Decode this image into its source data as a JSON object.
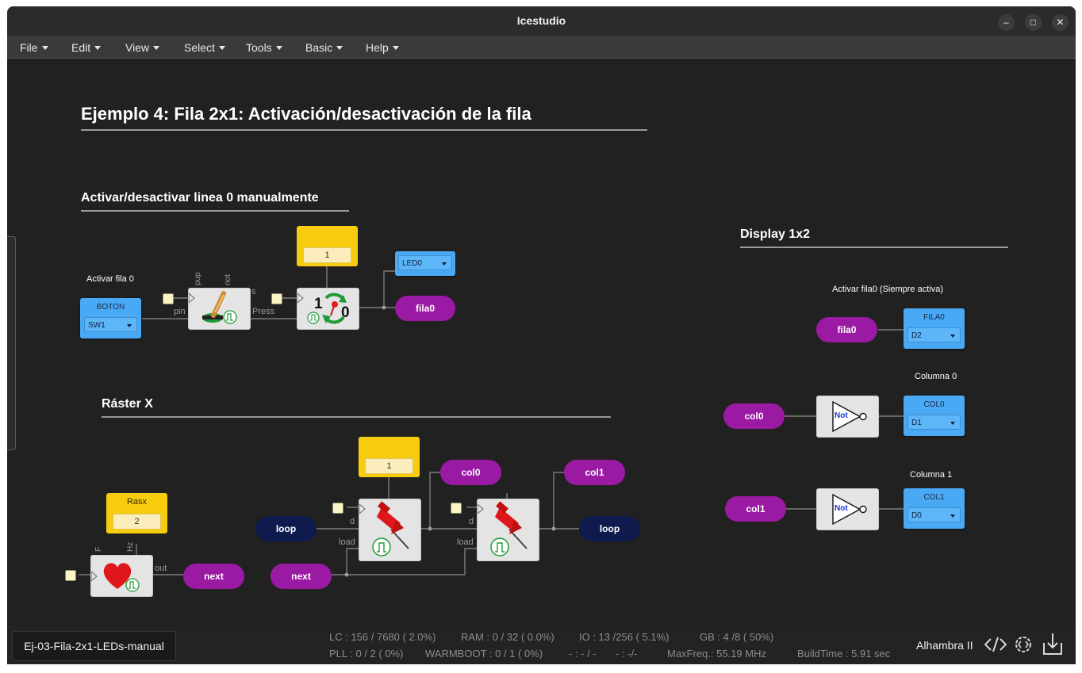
{
  "window": {
    "title": "Icestudio",
    "minimize": "–",
    "maximize": "□",
    "close": "✕"
  },
  "menu": [
    "File",
    "Edit",
    "View",
    "Select",
    "Tools",
    "Basic",
    "Help"
  ],
  "canvas": {
    "title": "Ejemplo 4: Fila 2x1: Activación/desactivación de la fila",
    "section_manual": "Activar/desactivar linea 0 manualmente",
    "section_raster": "Ráster X",
    "section_display": "Display 1x2",
    "boton_label": "Activar fila 0",
    "boton": {
      "name": "BOTON",
      "pin": "SW1"
    },
    "led0": {
      "pin": "LED0"
    },
    "button_ports": {
      "pin": "pin",
      "pup": "pup",
      "not": "not",
      "s": "s",
      "press": "Press"
    },
    "toggle_const": "1",
    "toggle_digits": {
      "one": "1",
      "zero": "0"
    },
    "fila0_tag": "fila0",
    "display_note": "Activar fila0 (Siempre activa)",
    "fila0_in": "fila0",
    "fila0_out": {
      "name": "FILA0",
      "pin": "D2"
    },
    "col0_title": "Columna 0",
    "col0_in": "col0",
    "col0_out": {
      "name": "COL0",
      "pin": "D1"
    },
    "col1_title": "Columna 1",
    "col1_in": "col1",
    "col1_out": {
      "name": "COL1",
      "pin": "D0"
    },
    "not_label": "Not",
    "rasx": {
      "name": "Rasx",
      "value": "2"
    },
    "heart_ports": {
      "f": "F",
      "hz": "Hz",
      "out": "out"
    },
    "next_out": "next",
    "loop_in": "loop",
    "next_in": "next",
    "reg_const": "1",
    "reg_ports": {
      "d": "d",
      "load": "load"
    },
    "col0_tag": "col0",
    "col1_tag": "col1",
    "loop_out": "loop"
  },
  "status": {
    "file": "Ej-03-Fila-2x1-LEDs-manual",
    "lc": "LC : 156 / 7680 ( 2.0%)",
    "ram": "RAM : 0 / 32 ( 0.0%)",
    "io": "IO :  13 /256  ( 5.1%)",
    "gb": "GB :  4 /8  ( 50%)",
    "pll": "PLL : 0 / 2 ( 0%)",
    "warmboot": "WARMBOOT : 0 / 1 ( 0%)",
    "dash1": "- : - / -",
    "dash2": "- :  -/-",
    "maxfreq": "MaxFreq.:  55.19 MHz",
    "buildtime": "BuildTime :   5.91 sec",
    "board": "Alhambra II"
  },
  "colors": {
    "purple": "#9b1aa3",
    "navy": "#0f1a4d",
    "blue": "#4aa9f5",
    "yellow": "#f7cc0f"
  },
  "icons": [
    "code-icon",
    "settings-code-icon",
    "download-icon",
    "button-icon",
    "toggle-icon",
    "pin-register-icon",
    "heart-icon",
    "clock-pulse-icon"
  ]
}
